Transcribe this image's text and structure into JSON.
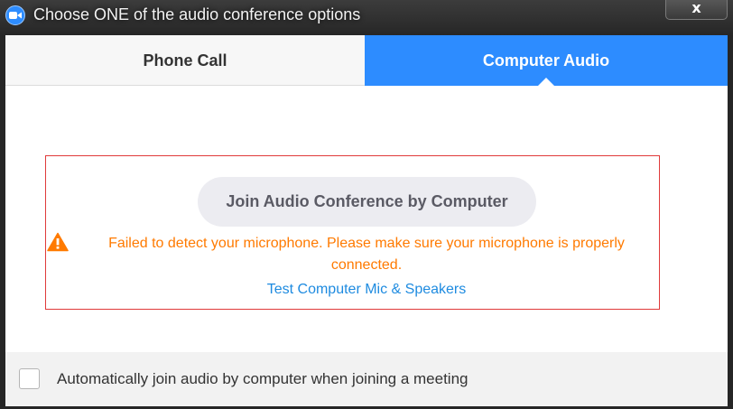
{
  "window": {
    "title": "Choose ONE of the audio conference options",
    "close_label": "x"
  },
  "tabs": [
    {
      "label": "Phone Call",
      "selected": false
    },
    {
      "label": "Computer Audio",
      "selected": true
    }
  ],
  "main": {
    "join_button_label": "Join Audio Conference by Computer",
    "error_message": "Failed to detect your microphone. Please make sure your microphone is properly connected.",
    "test_link": "Test Computer Mic & Speakers",
    "warning_icon": "warning-triangle-icon"
  },
  "footer": {
    "auto_join_label": "Automatically join audio by computer when joining a meeting",
    "auto_join_checked": false
  },
  "colors": {
    "accent": "#2d8cff",
    "error": "#ff7a00",
    "link": "#1e8be0",
    "highlight_border": "#e03a3a"
  }
}
